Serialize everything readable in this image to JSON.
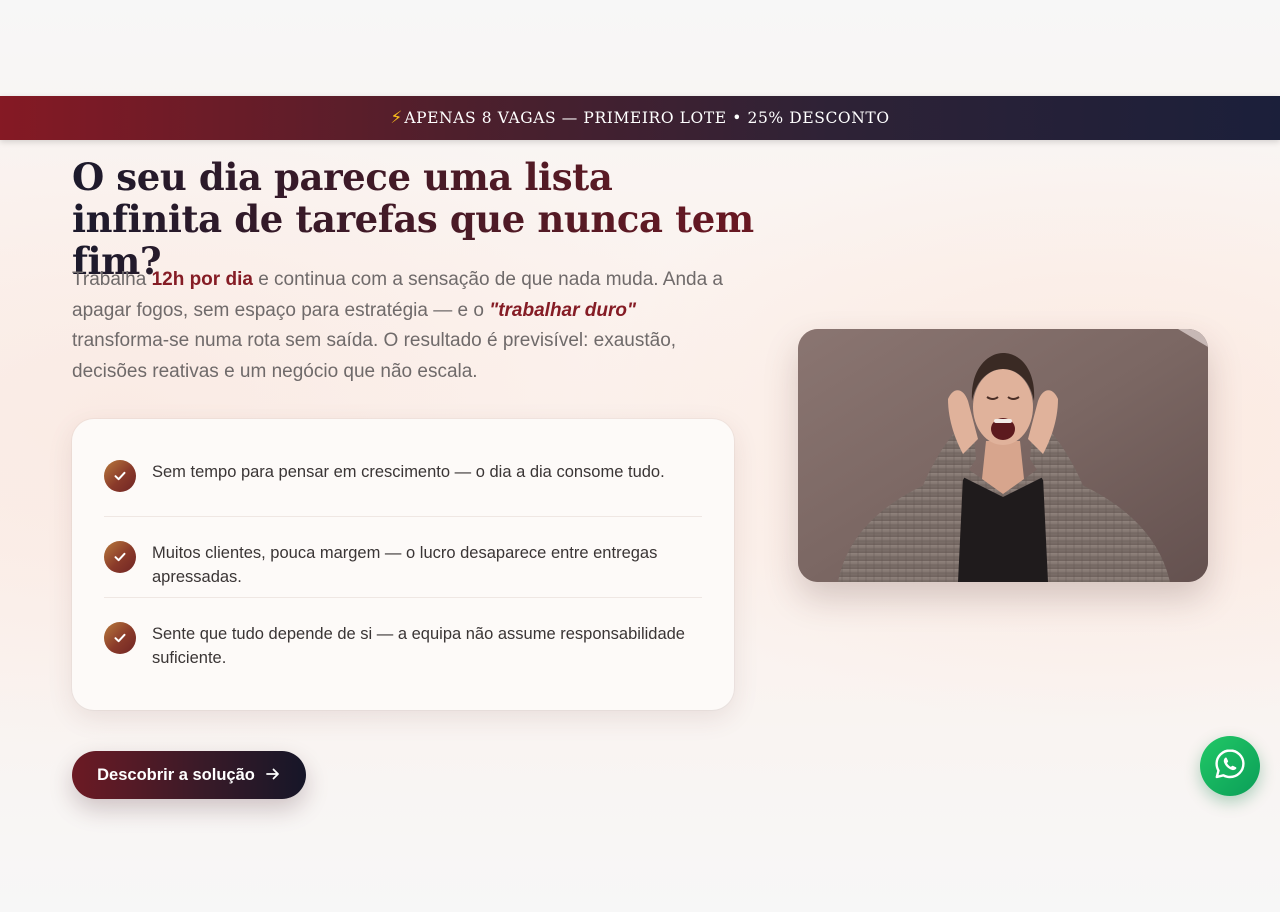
{
  "banner": {
    "icon": "lightning-bolt-icon",
    "text": "APENAS 8 VAGAS — PRIMEIRO LOTE • 25% DESCONTO"
  },
  "hero": {
    "headline": "O seu dia parece uma lista infinita de tarefas que nunca tem fim?",
    "paragraph": {
      "part1": "Trabalha ",
      "strong1": "12h por dia",
      "part2": " e continua com a sensação de que nada muda. Anda a apagar fogos, sem espaço para estratégia — e o ",
      "emph1": "\"trabalhar duro\"",
      "part3": " transforma-se numa rota sem saída. O resultado é previsível: exaustão, decisões reativas e um negócio que não escala."
    },
    "pain_points": [
      {
        "icon": "check-icon",
        "text": "Sem tempo para pensar em crescimento — o dia a dia consome tudo."
      },
      {
        "icon": "check-icon",
        "text": "Muitos clientes, pouca margem — o lucro desaparece entre entregas apressadas."
      },
      {
        "icon": "check-icon",
        "text": "Sente que tudo depende de si — a equipa não assume responsabilidade suficiente."
      }
    ],
    "cta": {
      "label": "Descobrir a solução",
      "icon": "arrow-right-icon"
    }
  },
  "image": {
    "subject": "photo-woman-shouting-with-hands-around-mouth"
  },
  "floating": {
    "whatsapp_icon": "whatsapp-icon"
  },
  "colors": {
    "accent": "#851c25",
    "banner_start": "#851924",
    "banner_end": "#1b1f3a",
    "whatsapp": "#25d366"
  }
}
